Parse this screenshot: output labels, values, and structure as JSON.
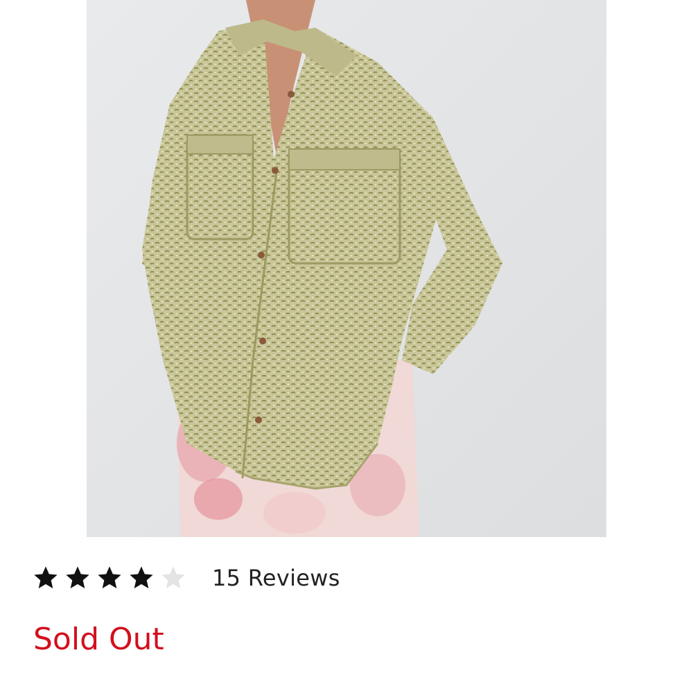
{
  "product": {
    "image_icon": "product-photo",
    "rating": {
      "value": 4,
      "max": 5,
      "reviews_label": "15 Reviews"
    },
    "availability": "Sold Out"
  },
  "colors": {
    "sold_out": "#d20f1d",
    "star_filled": "#111111",
    "star_empty": "#e4e4e4"
  }
}
